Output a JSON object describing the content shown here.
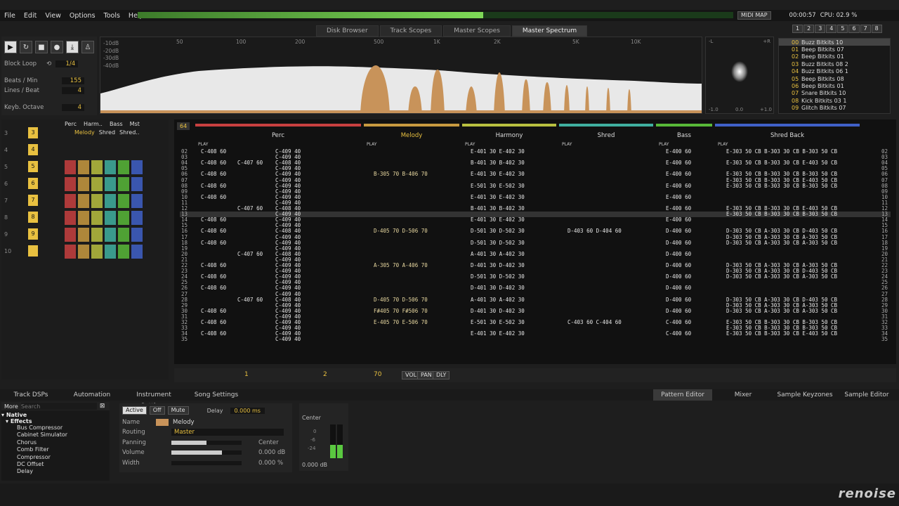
{
  "menu": [
    "File",
    "Edit",
    "View",
    "Options",
    "Tools",
    "Help"
  ],
  "topbar": {
    "midi_map": "MIDI MAP",
    "time": "00:00:57",
    "cpu": "CPU: 02.9 %"
  },
  "track_count_buttons": [
    "1",
    "2",
    "3",
    "4",
    "5",
    "6",
    "7",
    "8"
  ],
  "upper_tabs": [
    {
      "label": "Disk Browser",
      "active": false
    },
    {
      "label": "Track Scopes",
      "active": false
    },
    {
      "label": "Master Scopes",
      "active": false
    },
    {
      "label": "Master Spectrum",
      "active": true
    }
  ],
  "controls": {
    "block_loop_label": "Block Loop",
    "block_loop_value": "1/4",
    "bpm_label": "Beats / Min",
    "bpm_value": "155",
    "lpb_label": "Lines / Beat",
    "lpb_value": "4",
    "octave_label": "Keyb. Octave",
    "octave_value": "4"
  },
  "spectrum": {
    "db_labels": [
      "-10dB",
      "-20dB",
      "-30dB",
      "-40dB"
    ],
    "freq_labels": [
      "50",
      "100",
      "200",
      "500",
      "1K",
      "2K",
      "5K",
      "10K"
    ],
    "fill_color": "#c8935a"
  },
  "scope": {
    "left": "-L",
    "right": "+R",
    "axis": [
      "-1.0",
      "0.0",
      "+1.0"
    ]
  },
  "instruments": [
    {
      "n": "00",
      "name": "Buzz Bitkits 10",
      "sel": true
    },
    {
      "n": "01",
      "name": "Beep Bitkits 07"
    },
    {
      "n": "02",
      "name": "Beep Bitkits 01"
    },
    {
      "n": "03",
      "name": "Buzz Bitkits 08 2"
    },
    {
      "n": "04",
      "name": "Buzz Bitkits 06 1"
    },
    {
      "n": "05",
      "name": "Beep Bitkits 08"
    },
    {
      "n": "06",
      "name": "Beep Bitkits 01"
    },
    {
      "n": "07",
      "name": "Snare Bitkits 10"
    },
    {
      "n": "08",
      "name": "Kick Bitkits 03 1"
    },
    {
      "n": "09",
      "name": "Glitch Bitkits 07"
    }
  ],
  "sequencer": {
    "positions": [
      "3",
      "4",
      "5",
      "6",
      "7",
      "8",
      "9",
      "10"
    ],
    "patterns": [
      "3",
      "4",
      "5",
      "6",
      "7",
      "8",
      "9"
    ],
    "track_labels_row1": [
      "Perc",
      "Harm..",
      "Bass",
      "Mst"
    ],
    "track_labels_row2": [
      "Melody",
      "Shred",
      "Shred.."
    ]
  },
  "pattern": {
    "lines_count": "64",
    "tracks": [
      {
        "name": "Perc",
        "color": "#c84040",
        "width": 240
      },
      {
        "name": "Melody",
        "color": "#c89a40",
        "width": 140
      },
      {
        "name": "Harmony",
        "color": "#b8c040",
        "width": 138
      },
      {
        "name": "Shred",
        "color": "#40b0a0",
        "width": 138
      },
      {
        "name": "Bass",
        "color": "#58b838",
        "width": 84
      },
      {
        "name": "Shred Back",
        "color": "#4060c8",
        "width": 210
      }
    ],
    "play_label": "PLAY",
    "rows": [
      {
        "n": "02",
        "c": [
          "C-408 60",
          "",
          "C-409 40",
          "",
          "E-401 30 E-402 30",
          "",
          "E-400 60",
          "E-303 50 CB B-303 30 CB B-303 50 CB"
        ]
      },
      {
        "n": "03",
        "c": [
          "",
          "",
          "C-409 40",
          "",
          "",
          "",
          "",
          ""
        ]
      },
      {
        "n": "04",
        "c": [
          "C-408 60",
          "C-407 60",
          "C-408 40",
          "",
          "B-401 30 B-402 30",
          "",
          "E-400 60",
          "E-303 50 CB B-303 30 CB E-403 50 CB"
        ]
      },
      {
        "n": "05",
        "c": [
          "",
          "",
          "C-409 40",
          "",
          "",
          "",
          "",
          ""
        ]
      },
      {
        "n": "06",
        "c": [
          "C-408 60",
          "",
          "C-409 40",
          "B-305 70 B-406 70",
          "E-401 30 E-402 30",
          "",
          "E-400 60",
          "E-303 50 CB B-303 30 CB B-303 50 CB"
        ]
      },
      {
        "n": "07",
        "c": [
          "",
          "",
          "C-409 40",
          "",
          "",
          "",
          "",
          "E-303 50 CB B-303 30 CB E-403 50 CB"
        ]
      },
      {
        "n": "08",
        "c": [
          "C-408 60",
          "",
          "C-409 40",
          "",
          "E-501 30 E-502 30",
          "",
          "E-400 60",
          "E-303 50 CB B-303 30 CB B-303 50 CB"
        ]
      },
      {
        "n": "09",
        "c": [
          "",
          "",
          "C-409 40",
          "",
          "",
          "",
          "",
          ""
        ]
      },
      {
        "n": "10",
        "c": [
          "C-408 60",
          "",
          "C-409 40",
          "",
          "E-401 30 E-402 30",
          "",
          "E-400 60",
          ""
        ]
      },
      {
        "n": "11",
        "c": [
          "",
          "",
          "C-409 40",
          "",
          "",
          "",
          "",
          ""
        ]
      },
      {
        "n": "12",
        "c": [
          "",
          "C-407 60",
          "C-408 40",
          "",
          "B-401 30 B-402 30",
          "",
          "E-400 60",
          "E-303 50 CB B-303 30 CB E-403 50 CB"
        ]
      },
      {
        "n": "13",
        "c": [
          "",
          "",
          "C-409 40",
          "",
          "",
          "",
          "",
          "E-303 50 CB B-303 30 CB B-303 50 CB"
        ]
      },
      {
        "n": "14",
        "c": [
          "C-408 60",
          "",
          "C-409 40",
          "",
          "E-401 30 E-402 30",
          "",
          "E-400 60",
          ""
        ]
      },
      {
        "n": "15",
        "c": [
          "",
          "",
          "C-409 40",
          "",
          "",
          "",
          "",
          ""
        ]
      },
      {
        "n": "16",
        "c": [
          "C-408 60",
          "",
          "C-408 40",
          "D-405 70 D-506 70",
          "D-501 30 D-502 30",
          "D-403 60 D-404 60",
          "D-400 60",
          "D-303 50 CB A-303 30 CB D-403 50 CB"
        ]
      },
      {
        "n": "17",
        "c": [
          "",
          "",
          "C-409 40",
          "",
          "",
          "",
          "",
          "D-303 50 CB A-303 30 CB A-303 50 CB"
        ]
      },
      {
        "n": "18",
        "c": [
          "C-408 60",
          "",
          "C-409 40",
          "",
          "D-501 30 D-502 30",
          "",
          "D-400 60",
          "D-303 50 CB A-303 30 CB A-303 50 CB"
        ]
      },
      {
        "n": "19",
        "c": [
          "",
          "",
          "C-409 40",
          "",
          "",
          "",
          "",
          ""
        ]
      },
      {
        "n": "20",
        "c": [
          "",
          "C-407 60",
          "C-408 40",
          "",
          "A-401 30 A-402 30",
          "",
          "D-400 60",
          ""
        ]
      },
      {
        "n": "21",
        "c": [
          "",
          "",
          "C-409 40",
          "",
          "",
          "",
          "",
          ""
        ]
      },
      {
        "n": "22",
        "c": [
          "C-408 60",
          "",
          "C-409 40",
          "A-305 70 A-406 70",
          "D-401 30 D-402 30",
          "",
          "D-400 60",
          "D-303 50 CB A-303 30 CB A-303 50 CB"
        ]
      },
      {
        "n": "23",
        "c": [
          "",
          "",
          "C-409 40",
          "",
          "",
          "",
          "",
          "D-303 50 CB A-303 30 CB D-403 50 CB"
        ]
      },
      {
        "n": "24",
        "c": [
          "C-408 60",
          "",
          "C-409 40",
          "",
          "D-501 30 D-502 30",
          "",
          "D-400 60",
          "D-303 50 CB A-303 30 CB A-303 50 CB"
        ]
      },
      {
        "n": "25",
        "c": [
          "",
          "",
          "C-409 40",
          "",
          "",
          "",
          "",
          ""
        ]
      },
      {
        "n": "26",
        "c": [
          "C-408 60",
          "",
          "C-409 40",
          "",
          "D-401 30 D-402 30",
          "",
          "D-400 60",
          ""
        ]
      },
      {
        "n": "27",
        "c": [
          "",
          "",
          "C-409 40",
          "",
          "",
          "",
          "",
          ""
        ]
      },
      {
        "n": "28",
        "c": [
          "",
          "C-407 60",
          "C-408 40",
          "D-405 70 D-506 70",
          "A-401 30 A-402 30",
          "",
          "D-400 60",
          "D-303 50 CB A-303 30 CB D-403 50 CB"
        ]
      },
      {
        "n": "29",
        "c": [
          "",
          "",
          "C-409 40",
          "",
          "",
          "",
          "",
          "D-303 50 CB A-303 30 CB A-303 50 CB"
        ]
      },
      {
        "n": "30",
        "c": [
          "C-408 60",
          "",
          "C-409 40",
          "F#405 70 F#506 70",
          "D-401 30 D-402 30",
          "",
          "D-400 60",
          "D-303 50 CB A-303 30 CB A-303 50 CB"
        ]
      },
      {
        "n": "31",
        "c": [
          "",
          "",
          "C-409 40",
          "",
          "",
          "",
          "",
          ""
        ]
      },
      {
        "n": "32",
        "c": [
          "C-408 60",
          "",
          "C-409 40",
          "E-405 70 E-506 70",
          "E-501 30 E-502 30",
          "C-403 60 C-404 60",
          "C-400 60",
          "E-303 50 CB B-303 30 CB B-303 50 CB"
        ]
      },
      {
        "n": "33",
        "c": [
          "",
          "",
          "C-409 40",
          "",
          "",
          "",
          "",
          "E-303 50 CB B-303 30 CB B-303 50 CB"
        ]
      },
      {
        "n": "34",
        "c": [
          "C-408 60",
          "",
          "C-409 40",
          "",
          "E-401 30 E-402 30",
          "",
          "C-400 60",
          "E-303 50 CB B-303 30 CB E-403 50 CB"
        ]
      },
      {
        "n": "35",
        "c": [
          "",
          "",
          "C-409 40",
          "",
          "",
          "",
          "",
          ""
        ]
      }
    ]
  },
  "pattern_bar": {
    "step": "1",
    "edit_step": "2",
    "volume": "70",
    "vol": "VOL",
    "pan": "PAN",
    "dly": "DLY"
  },
  "lower_tabs_left": [
    "Track DSPs",
    "Automation",
    "Instrument Settings",
    "Song Settings"
  ],
  "lower_tabs_right": [
    {
      "label": "Pattern Editor",
      "active": true
    },
    {
      "label": "Mixer",
      "active": false
    },
    {
      "label": "Sample Keyzones",
      "active": false
    },
    {
      "label": "Sample Editor",
      "active": false
    }
  ],
  "dsp": {
    "more": "More",
    "search_placeholder": "Search",
    "root": "Native",
    "group": "Effects",
    "items": [
      "Bus Compressor",
      "Cabinet Simulator",
      "Chorus",
      "Comb Filter",
      "Compressor",
      "DC Offset",
      "Delay"
    ]
  },
  "track_cfg": {
    "active": "Active",
    "off": "Off",
    "mute": "Mute",
    "delay_label": "Delay",
    "delay_value": "0.000 ms",
    "name_label": "Name",
    "name_value": "Melody",
    "routing_label": "Routing",
    "routing_value": "Master",
    "panning_label": "Panning",
    "panning_value": "Center",
    "volume_label": "Volume",
    "volume_value": "0.000 dB",
    "width_label": "Width",
    "width_value": "0.000 %"
  },
  "master_meter": {
    "label": "Center",
    "scale": [
      "0",
      "-6",
      "-24"
    ],
    "value": "0.000 dB"
  },
  "logo": "renoise"
}
